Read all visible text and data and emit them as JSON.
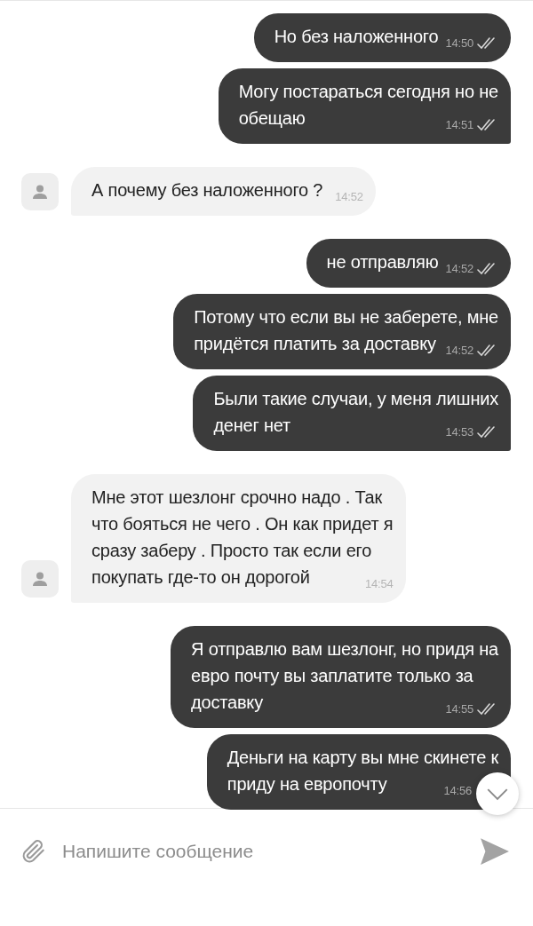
{
  "messages": [
    {
      "kind": "outgoing",
      "lines": [
        "Но без наложенного"
      ],
      "time": "14:50",
      "read": true,
      "last_in_group": false
    },
    {
      "kind": "outgoing",
      "lines": [
        "Могу постараться сегодня но не",
        "обещаю"
      ],
      "time": "14:51",
      "read": true,
      "last_in_group": true
    },
    {
      "kind": "incoming",
      "lines": [
        "А почему без наложенного ?"
      ],
      "time": "14:52",
      "last_in_group": true
    },
    {
      "kind": "outgoing",
      "lines": [
        "не отправляю"
      ],
      "time": "14:52",
      "read": true,
      "last_in_group": false
    },
    {
      "kind": "outgoing",
      "lines": [
        "Потому что если вы не заберете, мне",
        "придётся платить за доставку"
      ],
      "time": "14:52",
      "read": true,
      "last_in_group": false
    },
    {
      "kind": "outgoing",
      "lines": [
        "Были такие случаи, у меня лишних",
        "денег нет"
      ],
      "time": "14:53",
      "read": true,
      "last_in_group": true
    },
    {
      "kind": "incoming",
      "lines": [
        "Мне этот шезлонг срочно надо . Так",
        "что бояться не чего . Он как придет я",
        "сразу заберу . Просто так если его",
        "покупать где-то он дорогой"
      ],
      "time": "14:54",
      "last_in_group": true
    },
    {
      "kind": "outgoing",
      "lines": [
        "Я отправлю вам шезлонг, но придя на",
        "евро почту вы заплатите только за",
        "доставку"
      ],
      "time": "14:55",
      "read": true,
      "last_in_group": false
    },
    {
      "kind": "outgoing",
      "lines": [
        "Деньги на карту вы мне скинете к",
        "приду на европочту"
      ],
      "time": "14:56"
    }
  ],
  "composer": {
    "placeholder": "Напишите сообщение"
  }
}
